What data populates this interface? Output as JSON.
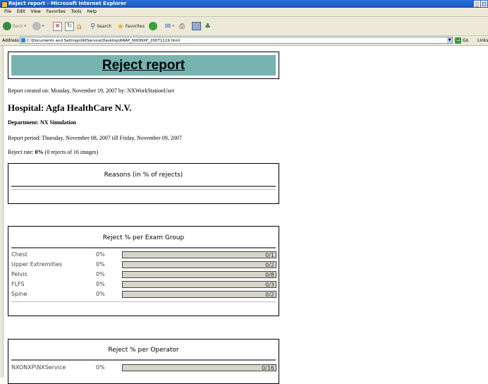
{
  "window": {
    "title": "Reject report - Microsoft Internet Explorer",
    "controls": [
      "_",
      "□"
    ]
  },
  "menu": [
    "File",
    "Edit",
    "View",
    "Favorites",
    "Tools",
    "Help"
  ],
  "toolbar": {
    "back": "Back",
    "search": "Search",
    "favorites": "Favorites"
  },
  "address": {
    "label": "Address",
    "value": "C:\\Documents and Settings\\NXService\\Desktop\\RRAP_NXONXP_20071119.html",
    "go": "Go",
    "links": "Links"
  },
  "report": {
    "title": "Reject report",
    "created": "Report created on: Monday, November 19, 2007 by: NXWorkStationUser",
    "hospital": "Hospital: Agfa HealthCare N.V.",
    "department": "Department: NX Simulation",
    "period": "Report period: Thursday, November 08, 2007 till Friday, November 09, 2007",
    "reject_rate_label": "Reject rate: ",
    "reject_rate_value": "0%",
    "reject_rate_detail": " (0 rejects of 16 images)"
  },
  "reasons_panel": {
    "title": "Reasons (in % of rejects)"
  },
  "exam_panel": {
    "title": "Reject % per Exam Group",
    "rows": [
      {
        "name": "Chest",
        "pct": "0%",
        "count": "0/1",
        "fill": 0
      },
      {
        "name": "Upper Extremities",
        "pct": "0%",
        "count": "0/2",
        "fill": 0
      },
      {
        "name": "Pelvis",
        "pct": "0%",
        "count": "0/8",
        "fill": 0
      },
      {
        "name": "FLFS",
        "pct": "0%",
        "count": "0/3",
        "fill": 0
      },
      {
        "name": "Spine",
        "pct": "0%",
        "count": "0/2",
        "fill": 0
      }
    ]
  },
  "operator_panel": {
    "title": "Reject % per Operator",
    "rows": [
      {
        "name": "NXONXP\\NXService",
        "pct": "0%",
        "count": "0/16",
        "fill": 0
      }
    ]
  },
  "colors": {
    "banner": "#76b4b1",
    "titlebar": "#1a56c4",
    "chrome": "#ece9d8"
  }
}
